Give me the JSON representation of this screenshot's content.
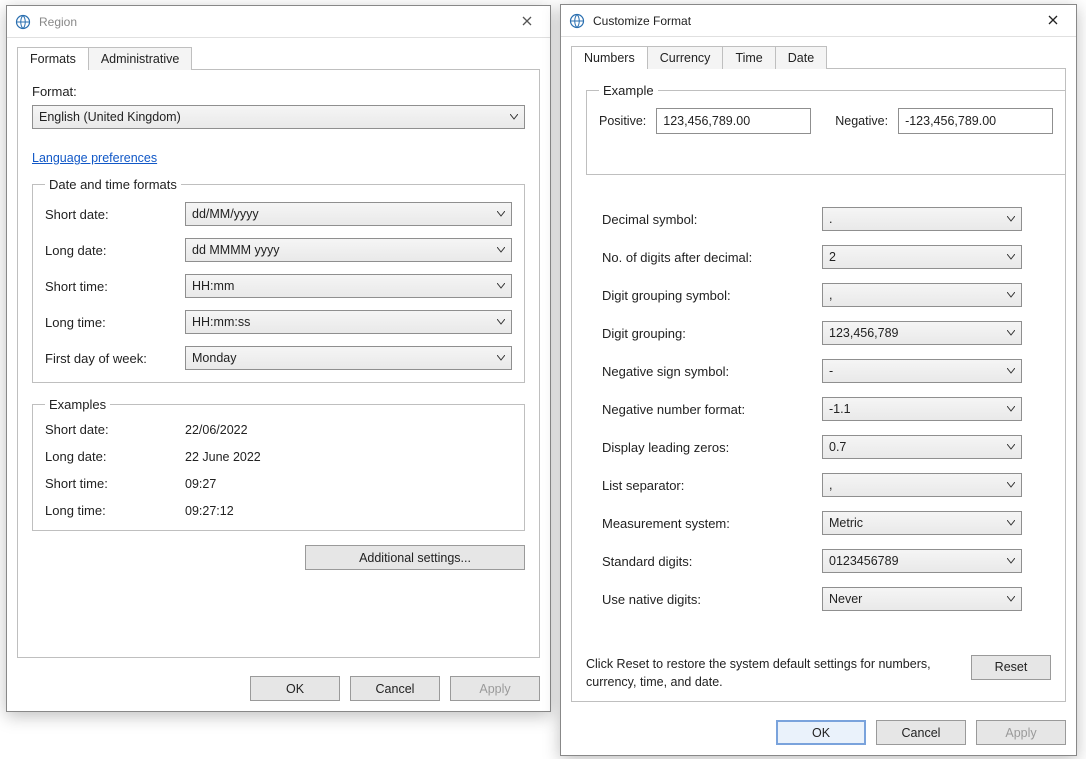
{
  "region": {
    "title": "Region",
    "tabs": [
      "Formats",
      "Administrative"
    ],
    "active_tab": 0,
    "format_label": "Format:",
    "format_value": "English (United Kingdom)",
    "lang_prefs": "Language preferences",
    "dt_legend": "Date and time formats",
    "dt": {
      "short_date_lbl": "Short date:",
      "short_date_val": "dd/MM/yyyy",
      "long_date_lbl": "Long date:",
      "long_date_val": "dd MMMM yyyy",
      "short_time_lbl": "Short time:",
      "short_time_val": "HH:mm",
      "long_time_lbl": "Long time:",
      "long_time_val": "HH:mm:ss",
      "first_day_lbl": "First day of week:",
      "first_day_val": "Monday"
    },
    "ex_legend": "Examples",
    "ex": {
      "short_date_lbl": "Short date:",
      "short_date_val": "22/06/2022",
      "long_date_lbl": "Long date:",
      "long_date_val": "22 June 2022",
      "short_time_lbl": "Short time:",
      "short_time_val": "09:27",
      "long_time_lbl": "Long time:",
      "long_time_val": "09:27:12"
    },
    "additional_settings": "Additional settings...",
    "ok": "OK",
    "cancel": "Cancel",
    "apply": "Apply"
  },
  "customize": {
    "title": "Customize Format",
    "tabs": [
      "Numbers",
      "Currency",
      "Time",
      "Date"
    ],
    "active_tab": 0,
    "example_legend": "Example",
    "positive_lbl": "Positive:",
    "positive_val": "123,456,789.00",
    "negative_lbl": "Negative:",
    "negative_val": "-123,456,789.00",
    "rows": [
      {
        "lbl": "Decimal symbol:",
        "val": "."
      },
      {
        "lbl": "No. of digits after decimal:",
        "val": "2"
      },
      {
        "lbl": "Digit grouping symbol:",
        "val": ","
      },
      {
        "lbl": "Digit grouping:",
        "val": "123,456,789"
      },
      {
        "lbl": "Negative sign symbol:",
        "val": "-"
      },
      {
        "lbl": "Negative number format:",
        "val": "-1.1"
      },
      {
        "lbl": "Display leading zeros:",
        "val": "0.7"
      },
      {
        "lbl": "List separator:",
        "val": ","
      },
      {
        "lbl": "Measurement system:",
        "val": "Metric"
      },
      {
        "lbl": "Standard digits:",
        "val": "0123456789"
      },
      {
        "lbl": "Use native digits:",
        "val": "Never"
      }
    ],
    "reset_text": "Click Reset to restore the system default settings for numbers, currency, time, and date.",
    "reset": "Reset",
    "ok": "OK",
    "cancel": "Cancel",
    "apply": "Apply"
  }
}
